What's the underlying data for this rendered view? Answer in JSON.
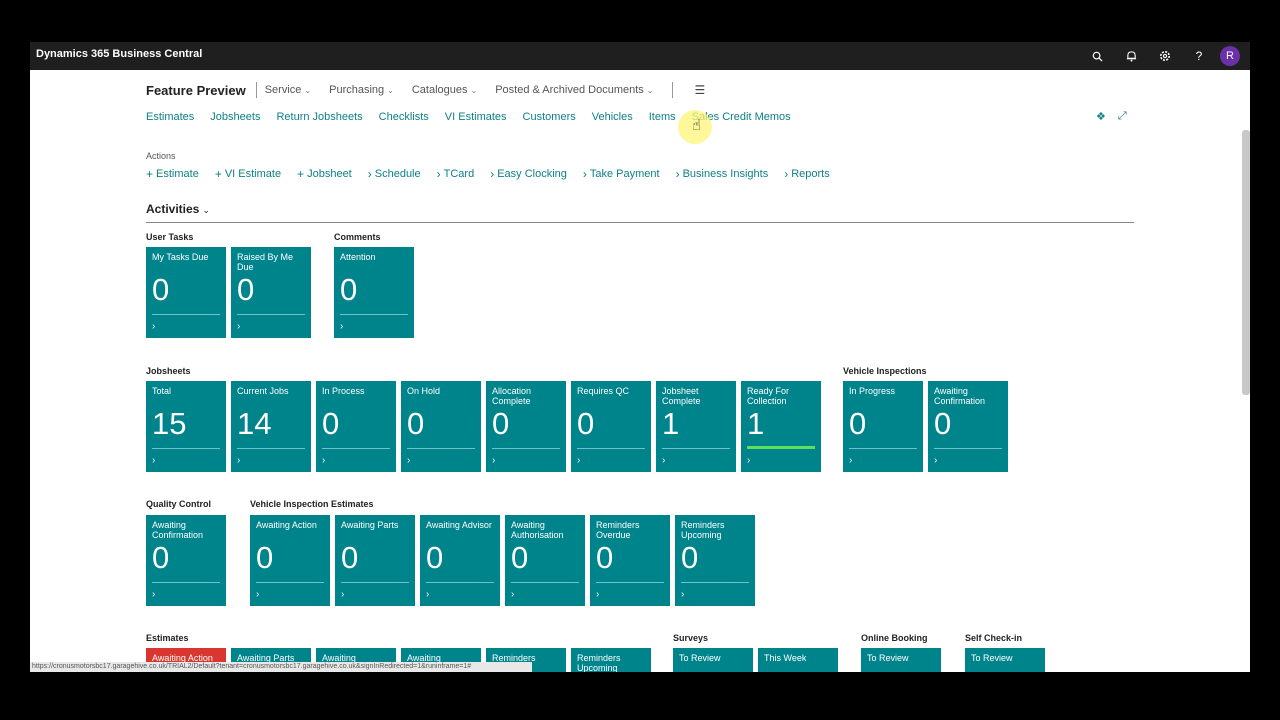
{
  "app": {
    "brand": "Dynamics 365 Business Central",
    "avatar_initial": "R"
  },
  "menu": {
    "title": "Feature Preview",
    "items": [
      {
        "label": "Service",
        "chevron": "chevron-down-icon"
      },
      {
        "label": "Purchasing",
        "chevron": "chevron-down-icon"
      },
      {
        "label": "Catalogues",
        "chevron": "chevron-down-icon"
      },
      {
        "label": "Posted & Archived Documents",
        "chevron": "chevron-down-icon"
      }
    ]
  },
  "nav": [
    "Estimates",
    "Jobsheets",
    "Return Jobsheets",
    "Checklists",
    "VI Estimates",
    "Customers",
    "Vehicles",
    "Items",
    "Sales Credit Memos"
  ],
  "actions": {
    "label": "Actions",
    "items": [
      {
        "label": "Estimate",
        "icon": "plus-icon"
      },
      {
        "label": "VI Estimate",
        "icon": "plus-icon"
      },
      {
        "label": "Jobsheet",
        "icon": "plus-icon"
      },
      {
        "label": "Schedule",
        "icon": "chevron-right-icon"
      },
      {
        "label": "TCard",
        "icon": "chevron-right-icon"
      },
      {
        "label": "Easy Clocking",
        "icon": "chevron-right-icon"
      },
      {
        "label": "Take Payment",
        "icon": "chevron-right-icon"
      },
      {
        "label": "Business Insights",
        "icon": "chevron-right-icon"
      },
      {
        "label": "Reports",
        "icon": "chevron-right-icon"
      }
    ]
  },
  "activities": {
    "title": "Activities"
  },
  "groups": {
    "user_tasks": {
      "label": "User Tasks",
      "tiles": [
        {
          "label": "My Tasks Due",
          "value": "0"
        },
        {
          "label": "Raised By Me Due",
          "value": "0"
        }
      ]
    },
    "comments": {
      "label": "Comments",
      "tiles": [
        {
          "label": "Attention",
          "value": "0"
        }
      ]
    },
    "jobsheets": {
      "label": "Jobsheets",
      "tiles": [
        {
          "label": "Total",
          "value": "15"
        },
        {
          "label": "Current Jobs",
          "value": "14"
        },
        {
          "label": "In Process",
          "value": "0"
        },
        {
          "label": "On Hold",
          "value": "0"
        },
        {
          "label": "Allocation Complete",
          "value": "0"
        },
        {
          "label": "Requires QC",
          "value": "0"
        },
        {
          "label": "Jobsheet Complete",
          "value": "1"
        },
        {
          "label": "Ready For Collection",
          "value": "1"
        }
      ]
    },
    "vehicle_inspections": {
      "label": "Vehicle Inspections",
      "tiles": [
        {
          "label": "In Progress",
          "value": "0"
        },
        {
          "label": "Awaiting Confirmation",
          "value": "0"
        }
      ]
    },
    "quality_control": {
      "label": "Quality Control",
      "tiles": [
        {
          "label": "Awaiting Confirmation",
          "value": "0"
        }
      ]
    },
    "vi_estimates": {
      "label": "Vehicle Inspection Estimates",
      "tiles": [
        {
          "label": "Awaiting Action",
          "value": "0"
        },
        {
          "label": "Awaiting Parts",
          "value": "0"
        },
        {
          "label": "Awaiting Advisor",
          "value": "0"
        },
        {
          "label": "Awaiting Authorisation",
          "value": "0"
        },
        {
          "label": "Reminders Overdue",
          "value": "0"
        },
        {
          "label": "Reminders Upcoming",
          "value": "0"
        }
      ]
    },
    "estimates": {
      "label": "Estimates",
      "tiles": [
        {
          "label": "Awaiting Action"
        },
        {
          "label": "Awaiting Parts"
        },
        {
          "label": "Awaiting"
        },
        {
          "label": "Awaiting"
        },
        {
          "label": "Reminders"
        },
        {
          "label": "Reminders Upcoming"
        }
      ]
    },
    "surveys": {
      "label": "Surveys",
      "tiles": [
        {
          "label": "To Review"
        },
        {
          "label": "This Week"
        }
      ]
    },
    "online_booking": {
      "label": "Online Booking",
      "tiles": [
        {
          "label": "To Review"
        }
      ]
    },
    "self_checkin": {
      "label": "Self Check-in",
      "tiles": [
        {
          "label": "To Review"
        }
      ]
    }
  },
  "status_url": "https://cronusmotorsbc17.garagehive.co.uk/TRIAL2/Default?tenant=cronusmotorsbc17.garagehive.co.uk&signInRedirected=1&runinframe=1#",
  "colors": {
    "tile": "#00848c",
    "tile_alert": "#d9362f",
    "link": "#0e8086",
    "topbar": "#1f1f1f",
    "progress": "#5ee05a"
  }
}
